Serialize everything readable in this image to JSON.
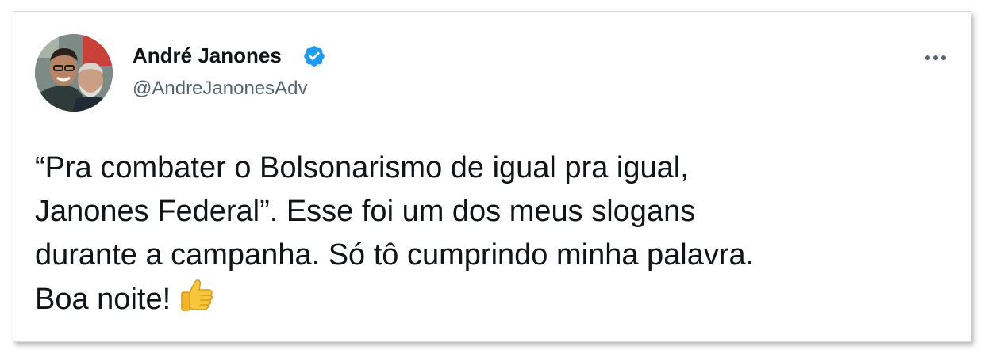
{
  "tweet": {
    "author": {
      "display_name": "André Janones",
      "handle": "@AndreJanonesAdv",
      "verified": true,
      "avatar_icon": "avatar-photo"
    },
    "more_icon": "ellipsis-icon",
    "text_lines": [
      "“Pra combater o Bolsonarismo de igual pra igual,",
      "Janones Federal”. Esse foi um dos meus slogans",
      "durante a campanha. Só tô cumprindo minha palavra.",
      "Boa noite!"
    ],
    "emoji": "thumbs-up-icon"
  },
  "colors": {
    "text": "#0f1419",
    "secondary_text": "#536471",
    "verified_blue": "#1d9bf0",
    "card_border": "#d9dde0"
  }
}
